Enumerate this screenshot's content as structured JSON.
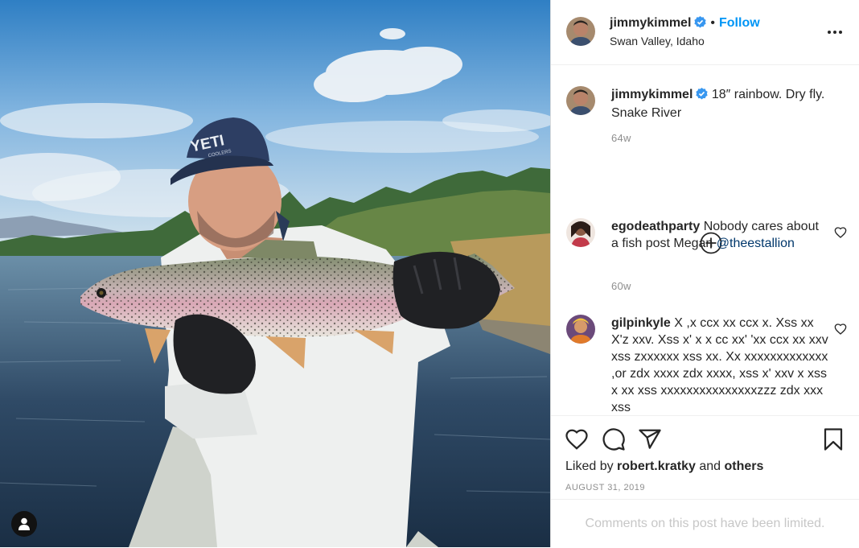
{
  "post": {
    "username": "jimmykimmel",
    "follow_label": "Follow",
    "separator": "•",
    "location": "Swan Valley, Idaho",
    "caption": "18″ rainbow. Dry fly. Snake River",
    "caption_time": "64w"
  },
  "comments": [
    {
      "username": "egodeathparty",
      "text": "Nobody cares about a fish post Megan ",
      "mention": "@theestallion",
      "time": "60w"
    },
    {
      "username": "gilpinkyle",
      "text": "X ,x ccx xx ccx x. Xss xx X'z xxv. Xss x' x x cc xx' 'xx ccx xx xxv xss zxxxxxx xss xx. Xx xxxxxxxxxxxxx ,or zdx xxxx zdx xxxx, xss x' xxv x xss x xx xss xxxxxxxxxxxxxxxzzz zdx xxx xss",
      "mention": ""
    }
  ],
  "likes": {
    "prefix": "Liked by ",
    "user": "robert.kratky",
    "and": " and ",
    "others": "others"
  },
  "date": "AUGUST 31, 2019",
  "comments_limited": "Comments on this post have been limited.",
  "photo": {
    "cap_text": "YETI",
    "cap_subtext": "COOLERS"
  },
  "colors": {
    "accent": "#0095f6",
    "text": "#262626",
    "muted": "#8e8e8e",
    "verified": "#3897f0"
  },
  "icons": [
    "more-options-icon",
    "verified-icon",
    "add-circle-icon",
    "heart-icon",
    "comment-icon",
    "share-icon",
    "bookmark-icon",
    "user-tag-icon"
  ]
}
